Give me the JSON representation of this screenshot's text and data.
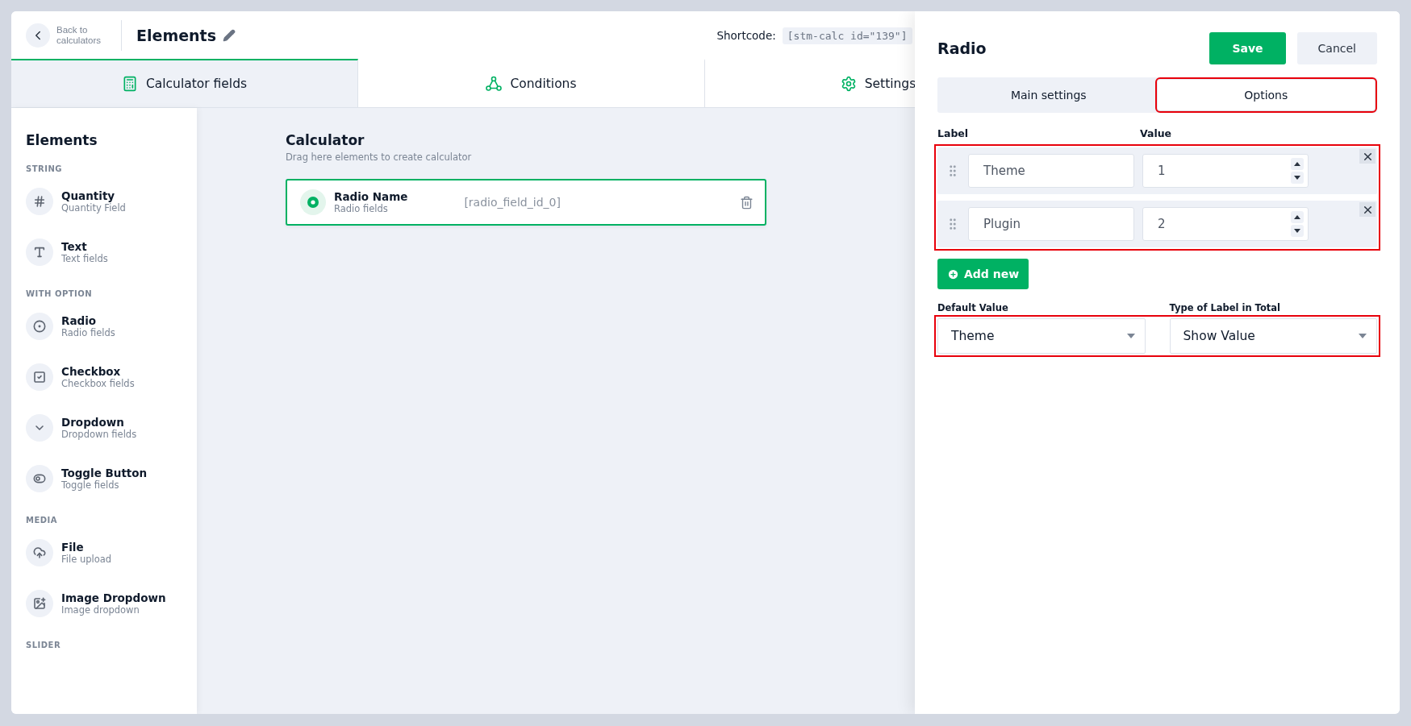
{
  "header": {
    "back_label": "Back to calculators",
    "title": "Elements",
    "shortcode_label": "Shortcode:",
    "shortcode": "[stm-calc id=\"139\"]"
  },
  "tabs": [
    {
      "label": "Calculator fields",
      "kind": "calculator",
      "selected": true
    },
    {
      "label": "Conditions",
      "kind": "conditions",
      "selected": false
    },
    {
      "label": "Settings",
      "kind": "settings",
      "selected": false
    }
  ],
  "sidebar": {
    "title": "Elements",
    "groups": [
      {
        "heading": "STRING",
        "items": [
          {
            "kind": "quantity",
            "name": "Quantity",
            "subtitle": "Quantity Field"
          },
          {
            "kind": "text",
            "name": "Text",
            "subtitle": "Text fields"
          }
        ]
      },
      {
        "heading": "WITH OPTION",
        "items": [
          {
            "kind": "radio",
            "name": "Radio",
            "subtitle": "Radio fields"
          },
          {
            "kind": "checkbox",
            "name": "Checkbox",
            "subtitle": "Checkbox fields"
          },
          {
            "kind": "dropdown",
            "name": "Dropdown",
            "subtitle": "Dropdown fields"
          },
          {
            "kind": "toggle",
            "name": "Toggle Button",
            "subtitle": "Toggle fields"
          }
        ]
      },
      {
        "heading": "MEDIA",
        "items": [
          {
            "kind": "file",
            "name": "File",
            "subtitle": "File upload"
          },
          {
            "kind": "image",
            "name": "Image Dropdown",
            "subtitle": "Image dropdown"
          }
        ]
      },
      {
        "heading": "SLIDER"
      }
    ]
  },
  "canvas": {
    "title": "Calculator",
    "subtitle": "Drag here elements to create calculator",
    "fields": [
      {
        "name": "Radio Name",
        "type": "Radio fields",
        "id": "[radio_field_id_0]"
      }
    ]
  },
  "panel": {
    "title": "Radio",
    "buttons": [
      {
        "label": "Save",
        "kind": "primary"
      },
      {
        "label": "Cancel",
        "kind": "secondary"
      }
    ],
    "tabs": [
      {
        "label": "Main settings",
        "selected": false,
        "highlighted": false
      },
      {
        "label": "Options",
        "selected": true,
        "highlighted": true
      }
    ],
    "columns": [
      "Label",
      "Value"
    ],
    "options": [
      {
        "label": "Theme",
        "value": "1"
      },
      {
        "label": "Plugin",
        "value": "2"
      }
    ],
    "options_highlighted": true,
    "add_button": "Add new",
    "selects": [
      {
        "label": "Default Value",
        "value": "Theme"
      },
      {
        "label": "Type of Label in Total",
        "value": "Show Value"
      }
    ],
    "selects_highlighted": true
  }
}
